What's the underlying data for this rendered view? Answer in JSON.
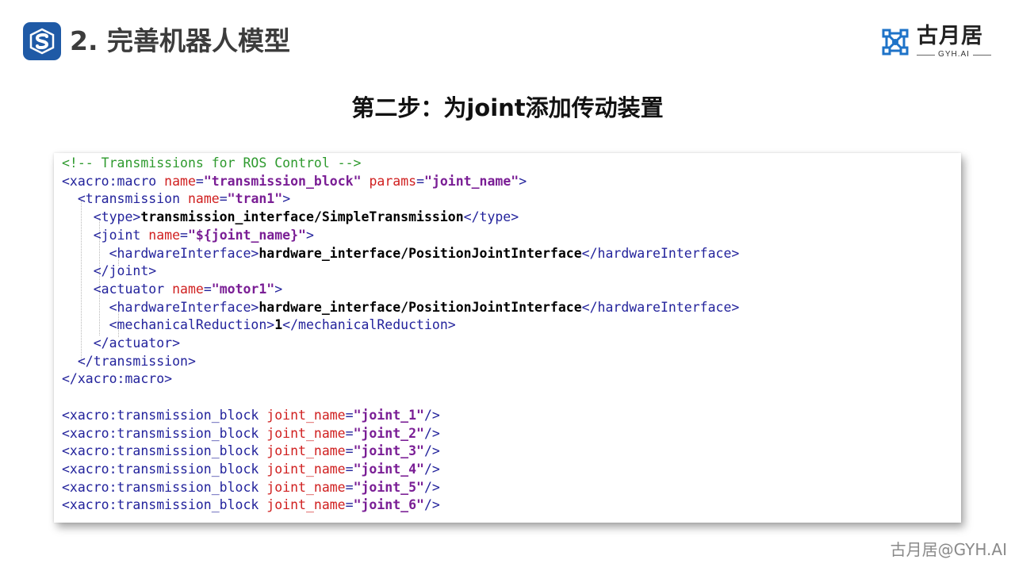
{
  "header": {
    "logo_icon": "s-box-logo-icon",
    "title": "2. 完善机器人模型",
    "brand_name": "古月居",
    "brand_sub": "GYH.AI"
  },
  "step_title": "第二步：为joint添加传动装置",
  "code": {
    "lines": [
      [
        {
          "t": "comment",
          "s": "<!-- Transmissions for ROS Control -->"
        }
      ],
      [
        {
          "t": "tag",
          "s": "<xacro:macro "
        },
        {
          "t": "attr",
          "s": "name"
        },
        {
          "t": "tag",
          "s": "="
        },
        {
          "t": "val",
          "s": "\"transmission_block\""
        },
        {
          "t": "tag",
          "s": " "
        },
        {
          "t": "attr",
          "s": "params"
        },
        {
          "t": "tag",
          "s": "="
        },
        {
          "t": "val",
          "s": "\"joint_name\""
        },
        {
          "t": "tag",
          "s": ">"
        }
      ],
      [
        {
          "t": "tag",
          "s": "  <transmission "
        },
        {
          "t": "attr",
          "s": "name"
        },
        {
          "t": "tag",
          "s": "="
        },
        {
          "t": "val",
          "s": "\"tran1\""
        },
        {
          "t": "tag",
          "s": ">"
        }
      ],
      [
        {
          "t": "tag",
          "s": "    <type>"
        },
        {
          "t": "text",
          "s": "transmission_interface/SimpleTransmission"
        },
        {
          "t": "tag",
          "s": "</type>"
        }
      ],
      [
        {
          "t": "tag",
          "s": "    <joint "
        },
        {
          "t": "attr",
          "s": "name"
        },
        {
          "t": "tag",
          "s": "="
        },
        {
          "t": "val",
          "s": "\"${joint_name}\""
        },
        {
          "t": "tag",
          "s": ">"
        }
      ],
      [
        {
          "t": "tag",
          "s": "      <hardwareInterface>"
        },
        {
          "t": "text",
          "s": "hardware_interface/PositionJointInterface"
        },
        {
          "t": "tag",
          "s": "</hardwareInterface>"
        }
      ],
      [
        {
          "t": "tag",
          "s": "    </joint>"
        }
      ],
      [
        {
          "t": "tag",
          "s": "    <actuator "
        },
        {
          "t": "attr",
          "s": "name"
        },
        {
          "t": "tag",
          "s": "="
        },
        {
          "t": "val",
          "s": "\"motor1\""
        },
        {
          "t": "tag",
          "s": ">"
        }
      ],
      [
        {
          "t": "tag",
          "s": "      <hardwareInterface>"
        },
        {
          "t": "text",
          "s": "hardware_interface/PositionJointInterface"
        },
        {
          "t": "tag",
          "s": "</hardwareInterface>"
        }
      ],
      [
        {
          "t": "tag",
          "s": "      <mechanicalReduction>"
        },
        {
          "t": "text",
          "s": "1"
        },
        {
          "t": "tag",
          "s": "</mechanicalReduction>"
        }
      ],
      [
        {
          "t": "tag",
          "s": "    </actuator>"
        }
      ],
      [
        {
          "t": "tag",
          "s": "  </transmission>"
        }
      ],
      [
        {
          "t": "tag",
          "s": "</xacro:macro>"
        }
      ],
      [],
      [
        {
          "t": "tag",
          "s": "<xacro:transmission_block "
        },
        {
          "t": "attr",
          "s": "joint_name"
        },
        {
          "t": "tag",
          "s": "="
        },
        {
          "t": "val",
          "s": "\"joint_1\""
        },
        {
          "t": "tag",
          "s": "/>"
        }
      ],
      [
        {
          "t": "tag",
          "s": "<xacro:transmission_block "
        },
        {
          "t": "attr",
          "s": "joint_name"
        },
        {
          "t": "tag",
          "s": "="
        },
        {
          "t": "val",
          "s": "\"joint_2\""
        },
        {
          "t": "tag",
          "s": "/>"
        }
      ],
      [
        {
          "t": "tag",
          "s": "<xacro:transmission_block "
        },
        {
          "t": "attr",
          "s": "joint_name"
        },
        {
          "t": "tag",
          "s": "="
        },
        {
          "t": "val",
          "s": "\"joint_3\""
        },
        {
          "t": "tag",
          "s": "/>"
        }
      ],
      [
        {
          "t": "tag",
          "s": "<xacro:transmission_block "
        },
        {
          "t": "attr",
          "s": "joint_name"
        },
        {
          "t": "tag",
          "s": "="
        },
        {
          "t": "val",
          "s": "\"joint_4\""
        },
        {
          "t": "tag",
          "s": "/>"
        }
      ],
      [
        {
          "t": "tag",
          "s": "<xacro:transmission_block "
        },
        {
          "t": "attr",
          "s": "joint_name"
        },
        {
          "t": "tag",
          "s": "="
        },
        {
          "t": "val",
          "s": "\"joint_5\""
        },
        {
          "t": "tag",
          "s": "/>"
        }
      ],
      [
        {
          "t": "tag",
          "s": "<xacro:transmission_block "
        },
        {
          "t": "attr",
          "s": "joint_name"
        },
        {
          "t": "tag",
          "s": "="
        },
        {
          "t": "val",
          "s": "\"joint_6\""
        },
        {
          "t": "tag",
          "s": "/>"
        }
      ]
    ]
  },
  "watermark": "古月居@GYH.AI",
  "colors": {
    "logo_bg": "#1f5aa6",
    "brand_mark": "#1e73c8",
    "comment": "#2e9a2e",
    "tag": "#23239c",
    "attribute": "#d02020",
    "value": "#7a1e95"
  }
}
